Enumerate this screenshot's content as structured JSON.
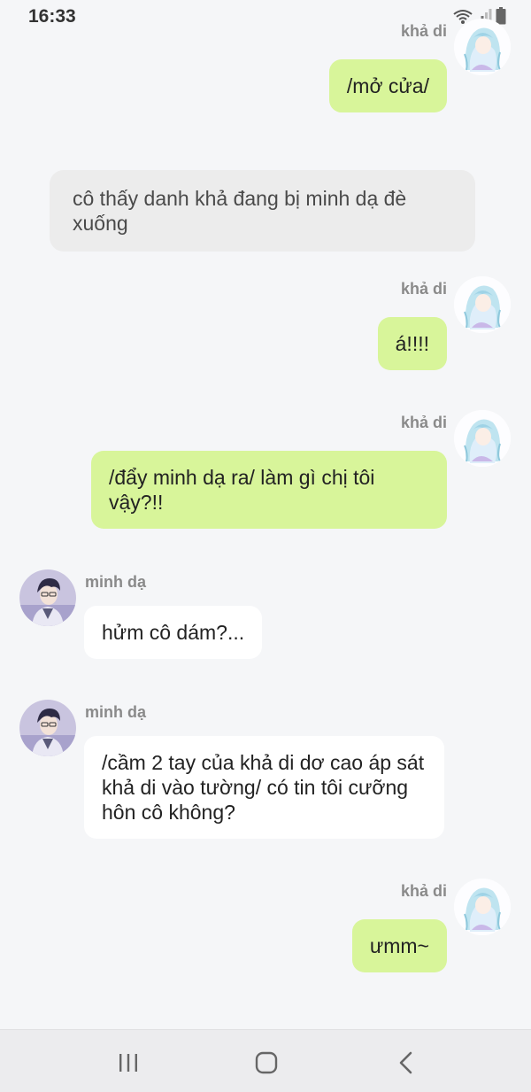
{
  "status": {
    "time": "16:33"
  },
  "messages": [
    {
      "id": "m1",
      "side": "right",
      "sender": "khả di",
      "text": "/mở cửa/"
    },
    {
      "id": "m2",
      "side": "narration",
      "text": "cô thấy danh khả đang bị minh dạ đè xuống"
    },
    {
      "id": "m3",
      "side": "right",
      "sender": "khả di",
      "text": "á!!!!"
    },
    {
      "id": "m4",
      "side": "right",
      "sender": "khả di",
      "text": "/đẩy minh dạ ra/ làm gì chị tôi vậy?!!"
    },
    {
      "id": "m5",
      "side": "left",
      "sender": "minh dạ",
      "text": "hửm cô dám?..."
    },
    {
      "id": "m6",
      "side": "left",
      "sender": "minh dạ",
      "text": "/cầm 2 tay của khả di dơ cao áp sát khả di vào tường/ có tin tôi cưỡng hôn cô không?"
    },
    {
      "id": "m7",
      "side": "right",
      "sender": "khả di",
      "text": "ưmm~"
    }
  ],
  "colors": {
    "background": "#f5f6f8",
    "bubble_self": "#d8f59a",
    "bubble_other": "#ffffff",
    "bubble_narration": "#ececec",
    "sender_name": "#8a8a8a"
  },
  "navbar": {
    "icons": [
      "recent-apps-icon",
      "home-icon",
      "back-icon"
    ]
  }
}
